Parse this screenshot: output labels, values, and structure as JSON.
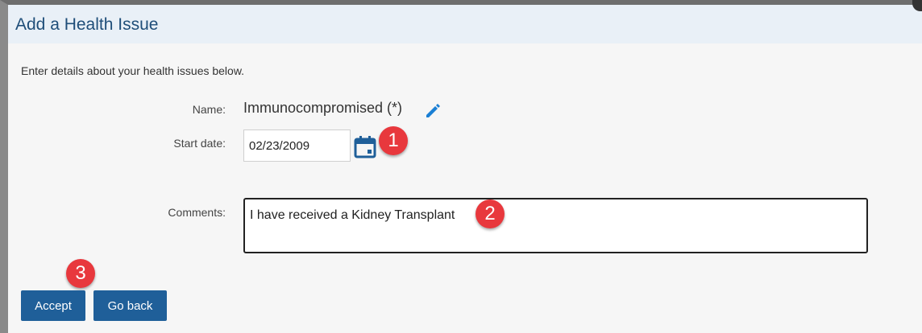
{
  "dialog": {
    "title": "Add a Health Issue",
    "intro": "Enter details about your health issues below."
  },
  "form": {
    "name_label": "Name:",
    "name_value": "Immunocompromised (*)",
    "start_date_label": "Start date:",
    "start_date_value": "02/23/2009",
    "comments_label": "Comments:",
    "comments_value": "I have received a Kidney Transplant"
  },
  "buttons": {
    "accept_label": "Accept",
    "back_label": "Go back"
  },
  "annotations": {
    "step1": "1",
    "step2": "2",
    "step3": "3"
  },
  "icons": {
    "edit": "pencil-icon",
    "date_picker": "calendar-icon"
  },
  "colors": {
    "accent": "#1f5f99",
    "title_text": "#1f4e79",
    "title_bar": "#e9f0f7",
    "badge": "#e8383d",
    "edit_icon": "#1a7fd4"
  }
}
